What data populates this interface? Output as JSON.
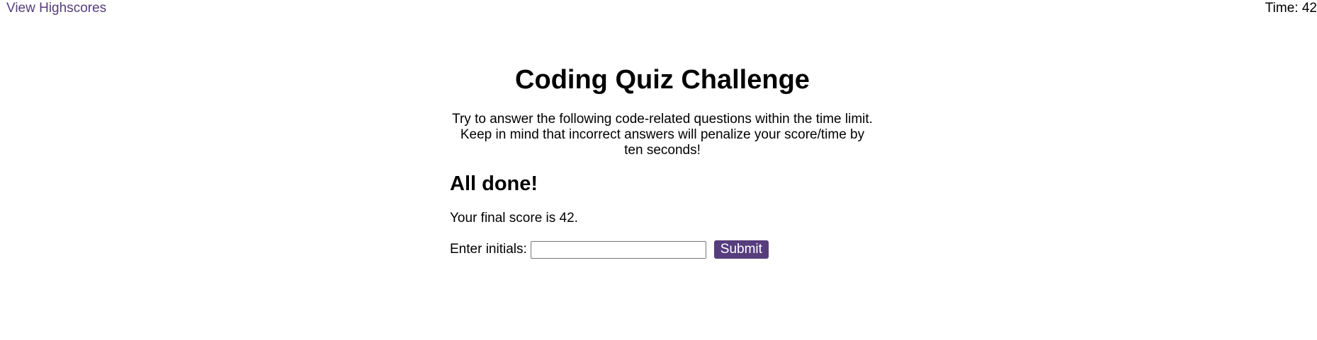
{
  "header": {
    "highscores_link": "View Highscores",
    "timer_text": "Time: 42"
  },
  "main": {
    "title": "Coding Quiz Challenge",
    "intro": "Try to answer the following code-related questions within the time limit. Keep in mind that incorrect answers will penalize your score/time by ten seconds!",
    "done_heading": "All done!",
    "final_score_text": "Your final score is 42.",
    "initials_label": "Enter initials:",
    "initials_value": "",
    "submit_label": "Submit"
  },
  "colors": {
    "accent": "#563d7c"
  }
}
